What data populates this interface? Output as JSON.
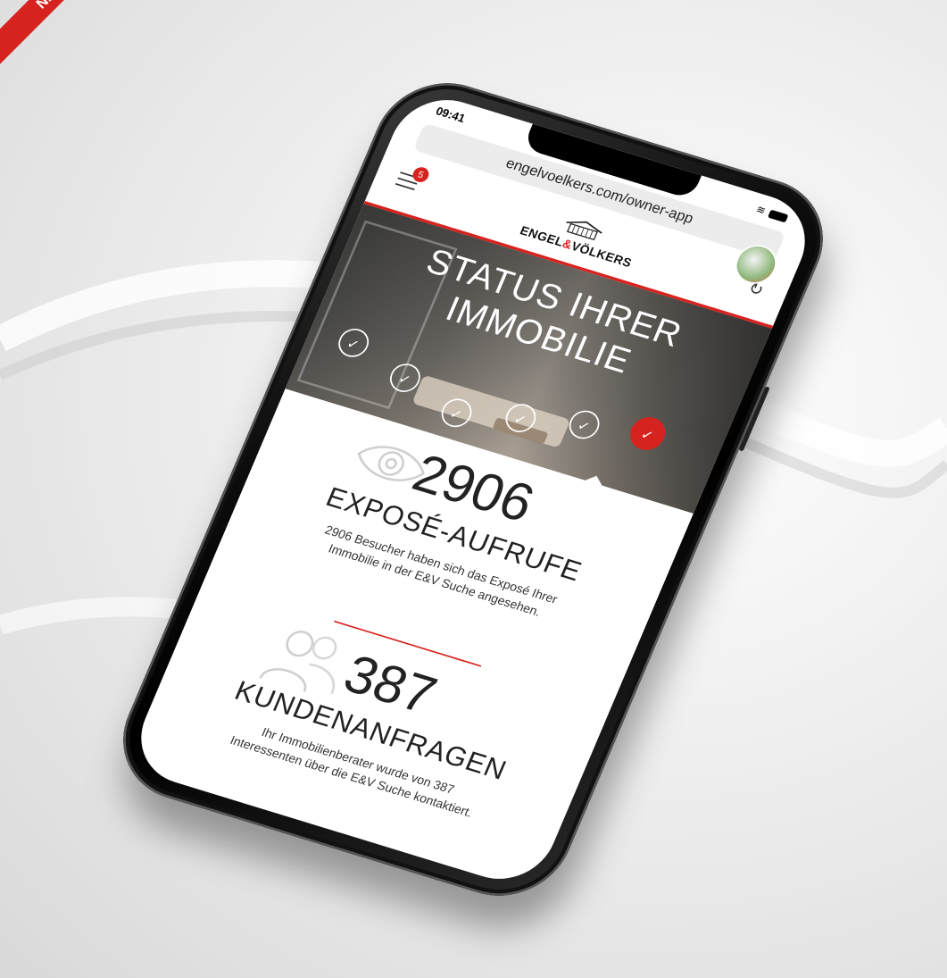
{
  "ribbon": {
    "text": "NEU"
  },
  "status_bar": {
    "time": "09:41"
  },
  "browser": {
    "url": "engelvoelkers.com/owner-app"
  },
  "header": {
    "menu_badge_count": "5",
    "logo_text_part1": "ENGEL",
    "logo_amp": "&",
    "logo_text_part2": "VÖLKERS"
  },
  "hero": {
    "title_line1": "STATUS IHRER",
    "title_line2": "IMMOBILIE",
    "steps_completed": 6,
    "step_glyph": "✓"
  },
  "stats": [
    {
      "number": "2906",
      "label": "EXPOSÉ-AUFRUFE",
      "description_line1": "2906 Besucher haben sich das Exposé Ihrer",
      "description_line2": "Immobilie in der E&V Suche angesehen."
    },
    {
      "number": "387",
      "label": "KUNDENANFRAGEN",
      "description_line1": "Ihr Immobilienberater wurde von 387",
      "description_line2": "Interessenten über die E&V Suche kontaktiert."
    }
  ],
  "colors": {
    "brand_red": "#d7231f",
    "phone_black": "#0d0d0d"
  }
}
